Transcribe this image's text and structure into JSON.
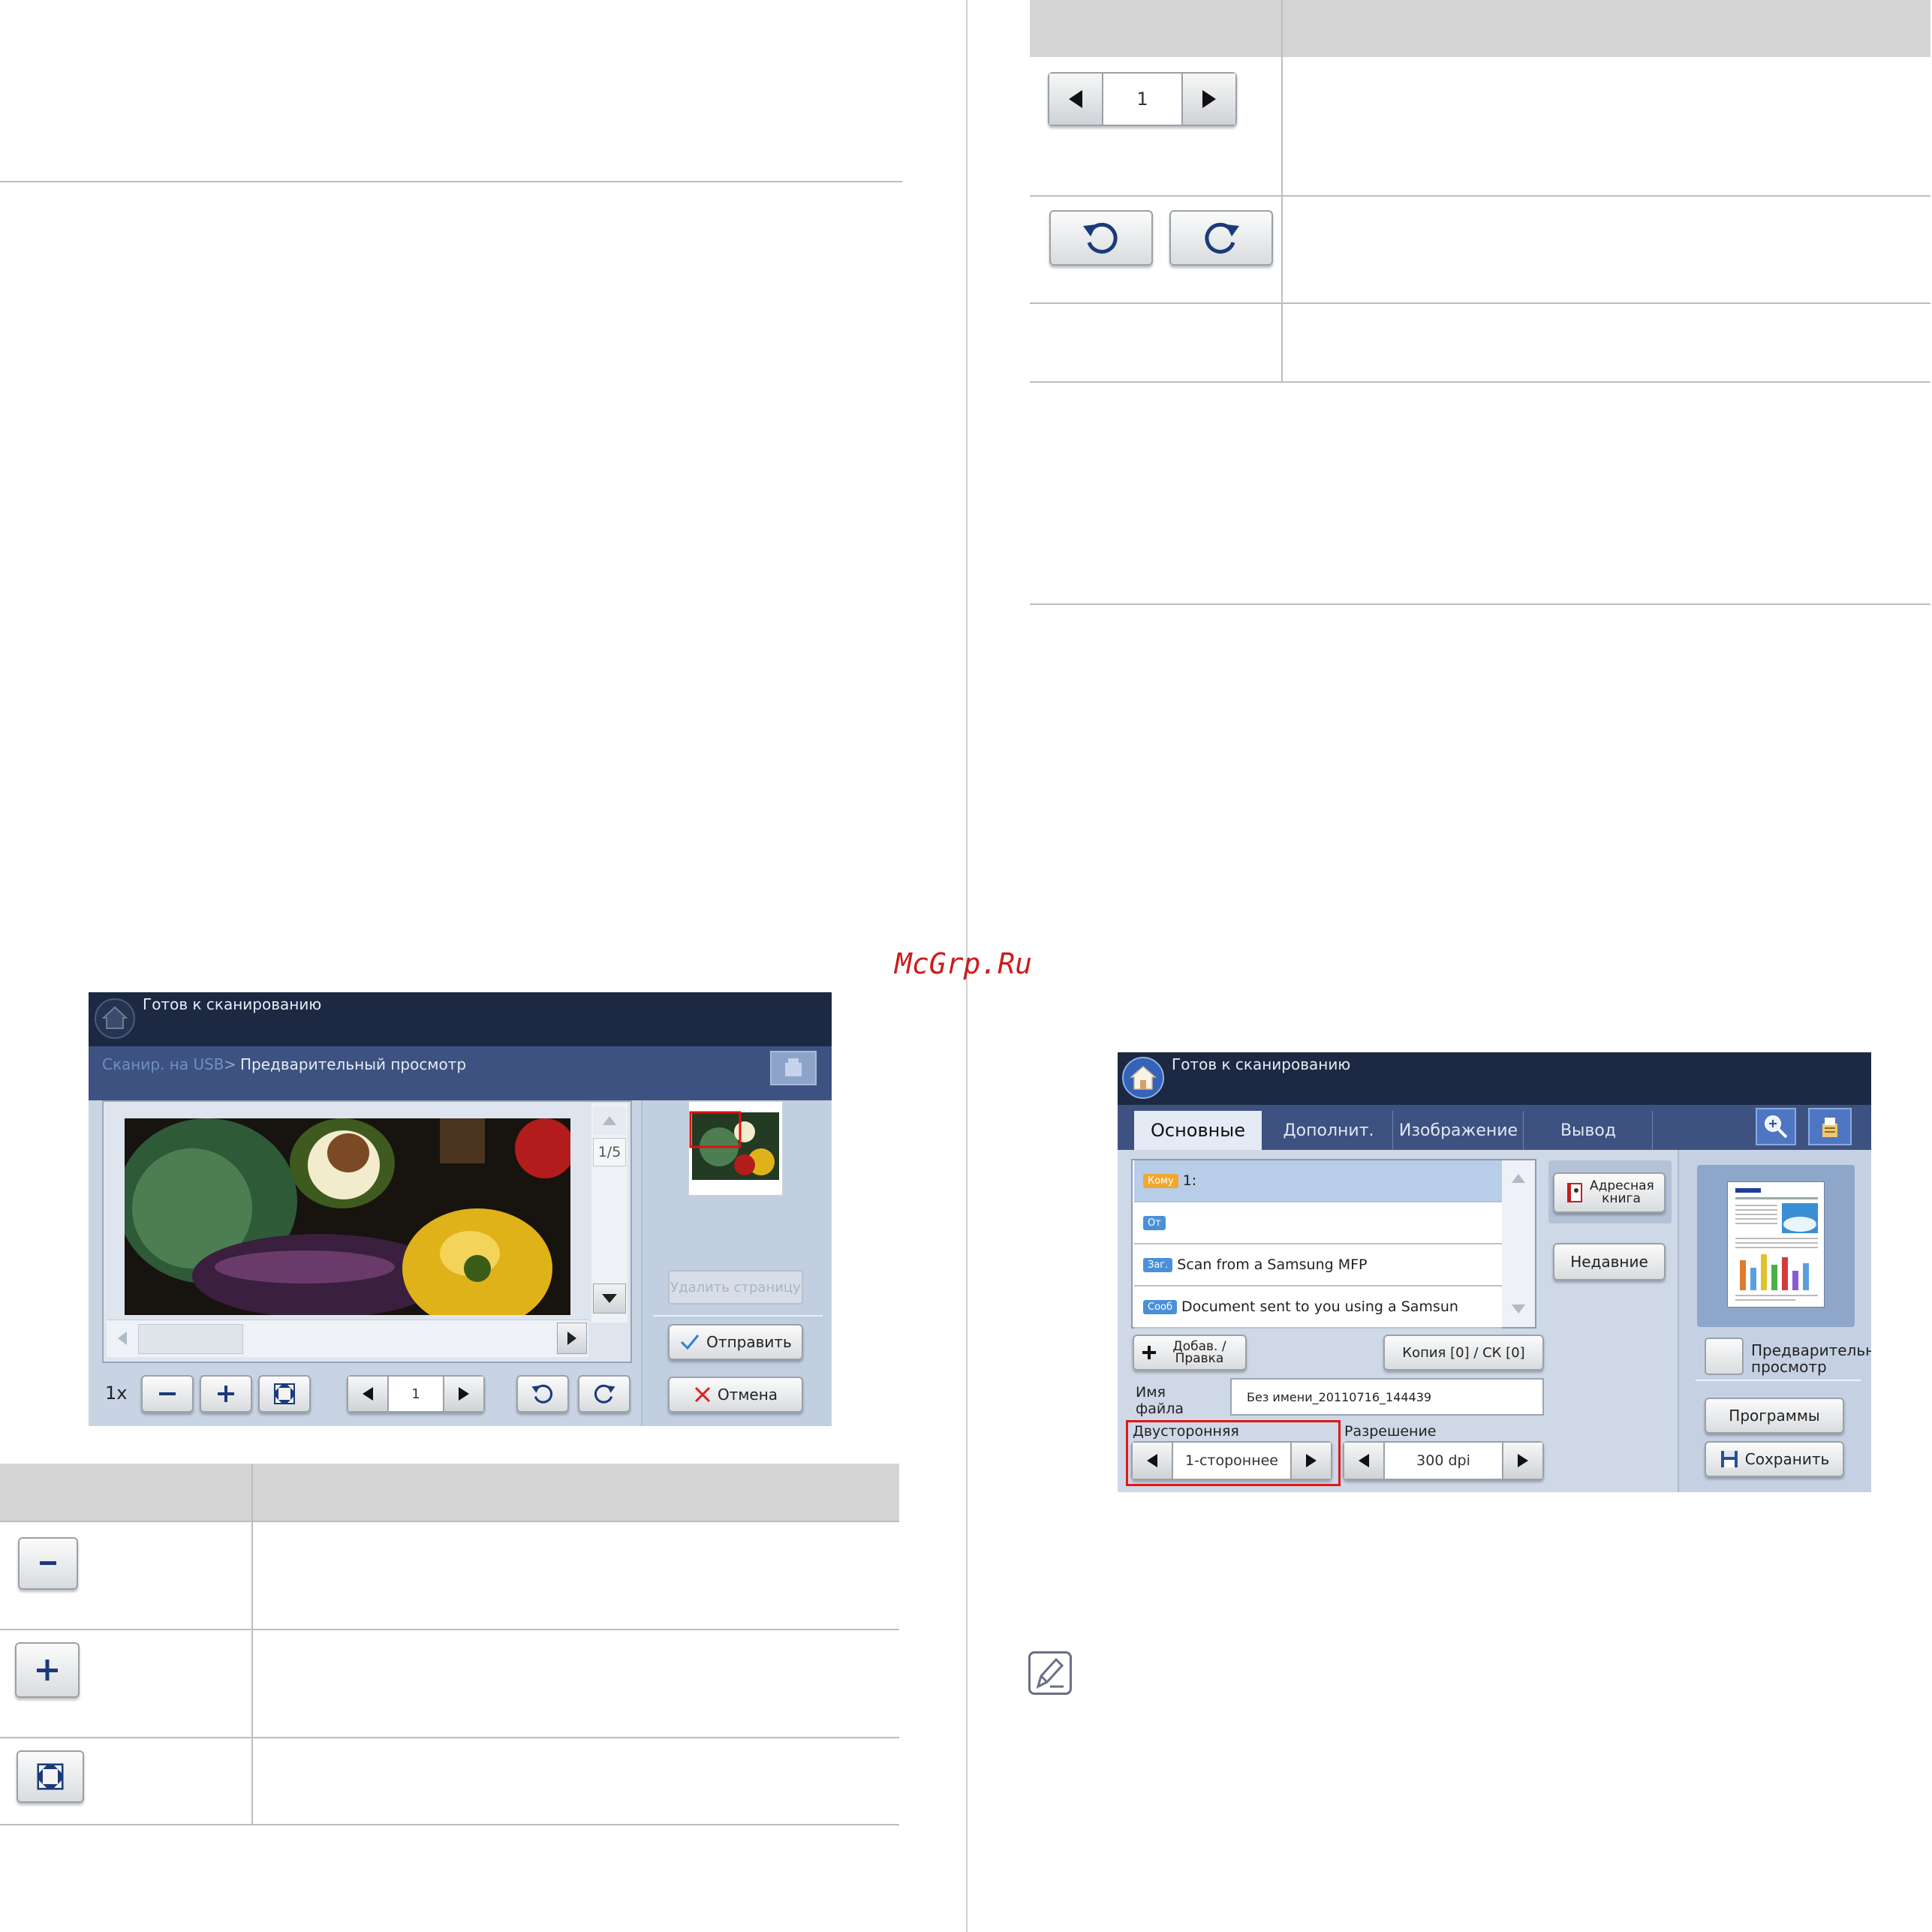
{
  "watermark": "McGrp.Ru",
  "screen1": {
    "status": "Готов к сканированию",
    "breadcrumb_parent": "Сканир. на USB",
    "breadcrumb_sep": ">",
    "breadcrumb_current": "Предварительный просмотр",
    "page_counter": "1/5",
    "zoom_label": "1x",
    "page_value": "1",
    "delete_page": "Удалить страницу",
    "send": "Отправить",
    "cancel": "Отмена"
  },
  "table_right": {
    "page_value": "1"
  },
  "screen2": {
    "status": "Готов к сканированию",
    "tabs": [
      "Основные",
      "Дополнит.",
      "Изображение",
      "Вывод"
    ],
    "to_tag": "Кому",
    "to_value": "1:",
    "from_tag": "От",
    "subject_tag": "Заг.",
    "subject_value": "Scan from a Samsung MFP",
    "message_tag": "Сооб",
    "message_value": "Document sent to you using a Samsun",
    "address_book": "Адресная книга",
    "recent": "Недавние",
    "add_edit": "Добав. / Правка",
    "copy_bcc": "Копия [0] / СК [0]",
    "filename_label": "Имя файла",
    "filename_value": "Без имени_20110716_144439",
    "duplex_label": "Двусторонняя",
    "duplex_value": "1-стороннее",
    "resolution_label": "Разрешение",
    "resolution_value": "300 dpi",
    "preview_label": "Предварительный просмотр",
    "programs": "Программы",
    "save": "Сохранить"
  }
}
